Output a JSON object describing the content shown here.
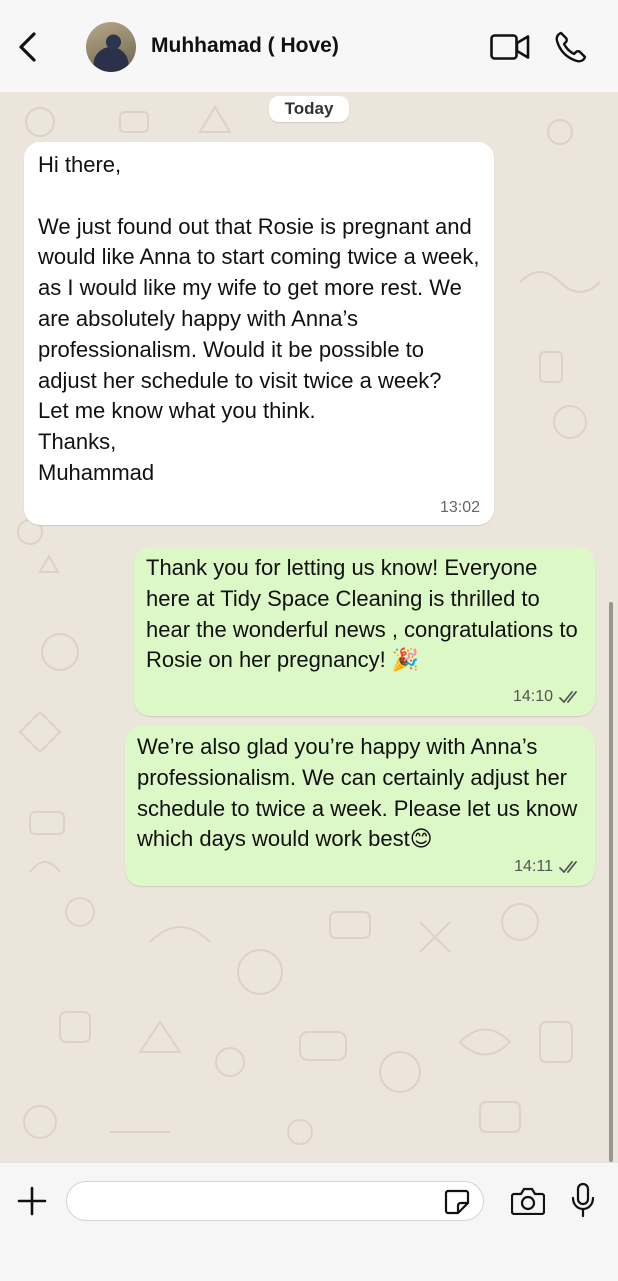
{
  "header": {
    "contact_name": "Muhhamad ( Hove)",
    "icons": [
      "back-chevron-icon",
      "contact-avatar",
      "video-call-icon",
      "phone-call-icon"
    ]
  },
  "chat": {
    "date_separator": "Today",
    "messages": [
      {
        "direction": "incoming",
        "text": "Hi there,\n\nWe just found out that Rosie is pregnant and would like Anna to start coming twice a week, as I would like my wife to get more rest. We are absolutely happy with Anna’s professionalism. Would it be possible to adjust her schedule to visit twice a week?\nLet me know what you think.\nThanks,\nMuhammad",
        "time": "13:02"
      },
      {
        "direction": "outgoing",
        "text": "Thank you for letting us know! Everyone here at Tidy Space Cleaning is thrilled to hear the wonderful news , congratulations to Rosie on her pregnancy! 🎉",
        "time": "14:10",
        "status": "read"
      },
      {
        "direction": "outgoing",
        "text": "We’re also glad you’re happy with Anna’s professionalism. We can certainly adjust her schedule to twice a week. Please let us know which days would work best😊",
        "time": "14:11",
        "status": "read"
      }
    ]
  },
  "composer": {
    "value": "",
    "icons": [
      "plus-icon",
      "sticker-icon",
      "camera-icon",
      "microphone-icon"
    ]
  },
  "colors": {
    "incoming_bubble": "#ffffff",
    "outgoing_bubble": "#dcf8c6",
    "wallpaper": "#ece5dc",
    "bar": "#f6f6f6"
  }
}
